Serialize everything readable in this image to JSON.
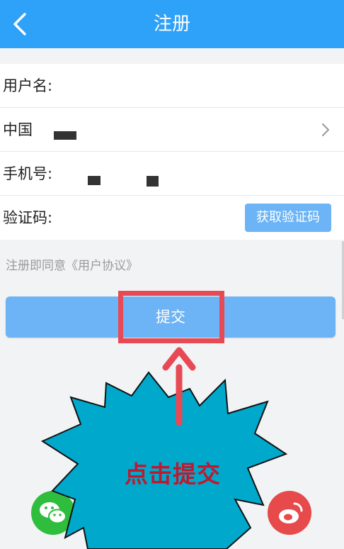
{
  "header": {
    "title": "注册",
    "back_icon": "chevron-left-icon"
  },
  "form": {
    "username_label": "用户名:",
    "region_label": "中国",
    "phone_label": "手机号:",
    "code_label": "验证码:",
    "get_code_label": "获取验证码"
  },
  "agreement_text": "注册即同意《用户协议》",
  "submit_label": "提交",
  "annotation": {
    "callout_text": "点击提交",
    "highlight_color": "#e84a55",
    "starburst_color": "#00a9cc"
  },
  "social": {
    "wechat_icon": "wechat-icon",
    "weibo_icon": "weibo-icon"
  },
  "colors": {
    "header": "#2ea1f8",
    "button": "#6cb4f6",
    "background": "#f2f3f5"
  }
}
